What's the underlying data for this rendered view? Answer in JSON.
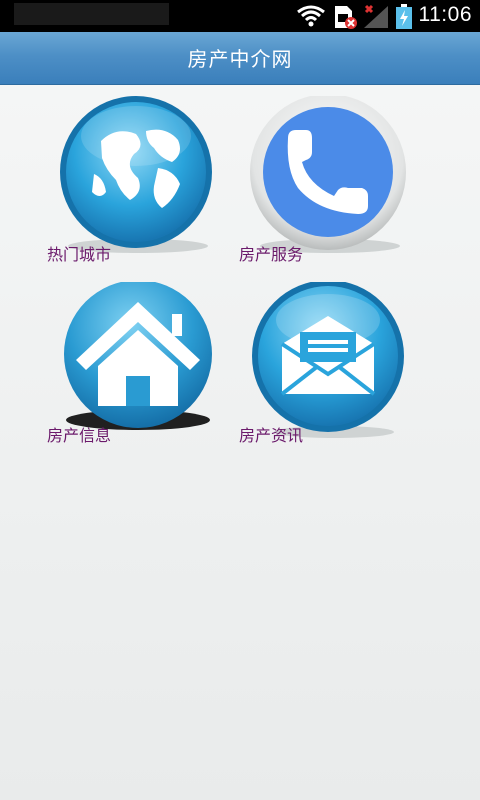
{
  "status_bar": {
    "time": "11:06",
    "icons": [
      "wifi-icon",
      "sim-card-icon",
      "no-signal-icon",
      "battery-charging-icon"
    ]
  },
  "app": {
    "title": "房产中介网"
  },
  "menu": {
    "items": [
      {
        "label": "热门城市",
        "icon": "globe-icon"
      },
      {
        "label": "房产服务",
        "icon": "phone-icon"
      },
      {
        "label": "房产信息",
        "icon": "house-icon"
      },
      {
        "label": "房产资讯",
        "icon": "mail-icon"
      }
    ]
  },
  "colors": {
    "title_bar": "#4d8fc6",
    "icon_blue": "#2aa4dc",
    "label_text": "#6b1a6b"
  }
}
